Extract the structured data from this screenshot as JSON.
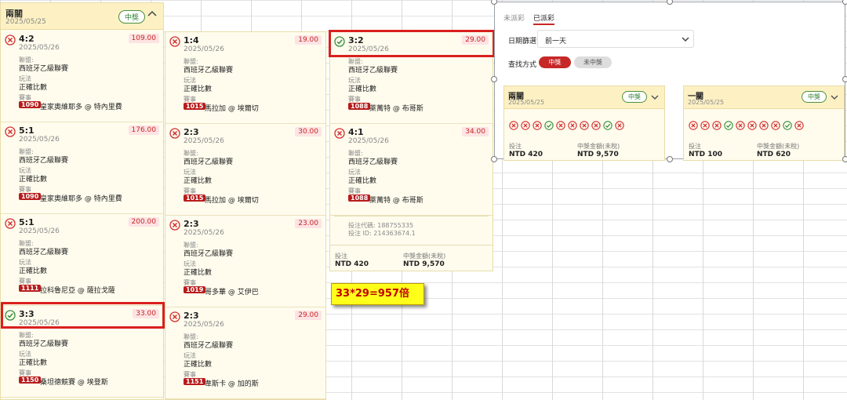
{
  "labels": {
    "league": "聯盟:",
    "play": "玩法",
    "match": "賽事",
    "bet": "投注",
    "payout": "中獎金額(未稅)",
    "bet_code": "投注代碼: 188755335",
    "bet_id": "投注 ID: 214363674.1"
  },
  "ticket1": {
    "title": "兩關",
    "date": "2025/05/25",
    "status": "中獎",
    "cards": [
      {
        "status": "lose",
        "score": "4:2",
        "date": "2025/05/26",
        "odds": "109.00",
        "league": "西班牙乙級聯賽",
        "play": "正確比數",
        "gid": "1090",
        "match": "皇家奧維耶多 @ 特內里費"
      },
      {
        "status": "lose",
        "score": "5:1",
        "date": "2025/05/26",
        "odds": "176.00",
        "league": "西班牙乙級聯賽",
        "play": "正確比數",
        "gid": "1090",
        "match": "皇家奧維耶多 @ 特內里費"
      },
      {
        "status": "lose",
        "score": "5:1",
        "date": "2025/05/26",
        "odds": "200.00",
        "league": "西班牙乙級聯賽",
        "play": "正確比數",
        "gid": "1111",
        "match": "拉科魯尼亞 @ 薩拉戈薩"
      },
      {
        "status": "win",
        "score": "3:3",
        "date": "2025/05/26",
        "odds": "33.00",
        "league": "西班牙乙級聯賽",
        "play": "正確比數",
        "gid": "1150",
        "match": "桑坦德競賽 @ 埃登斯"
      }
    ]
  },
  "ticket2": {
    "cards": [
      {
        "status": "lose",
        "score": "1:4",
        "date": "2025/05/26",
        "odds": "19.00",
        "league": "西班牙乙級聯賽",
        "play": "正確比數",
        "gid": "1015",
        "match": "馬拉加 @ 埃爾切"
      },
      {
        "status": "lose",
        "score": "2:3",
        "date": "2025/05/26",
        "odds": "30.00",
        "league": "西班牙乙級聯賽",
        "play": "正確比數",
        "gid": "1015",
        "match": "馬拉加 @ 埃爾切"
      },
      {
        "status": "lose",
        "score": "2:3",
        "date": "2025/05/26",
        "odds": "23.00",
        "league": "西班牙乙級聯賽",
        "play": "正確比數",
        "gid": "1019",
        "match": "哥多華 @ 艾伊巴"
      },
      {
        "status": "lose",
        "score": "2:3",
        "date": "2025/05/26",
        "odds": "29.00",
        "league": "西班牙乙級聯賽",
        "play": "正確比數",
        "gid": "1151",
        "match": "韋斯卡 @ 加的斯"
      }
    ]
  },
  "ticket3": {
    "cards": [
      {
        "status": "win",
        "score": "3:2",
        "date": "2025/05/26",
        "odds": "29.00",
        "league": "西班牙乙級聯賽",
        "play": "正確比數",
        "gid": "1088",
        "match": "萊萬特 @ 布哥斯"
      },
      {
        "status": "lose",
        "score": "4:1",
        "date": "2025/05/26",
        "odds": "34.00",
        "league": "西班牙乙級聯賽",
        "play": "正確比數",
        "gid": "1088",
        "match": "萊萬特 @ 布哥斯"
      }
    ],
    "bet_value": "NTD 420",
    "payout_value": "NTD 9,570"
  },
  "calc_note": "33*29=957倍",
  "panel": {
    "tab_unsettled": "未派彩",
    "tab_settled": "已派彩",
    "date_filter_label": "日期篩選",
    "date_filter_value": "前一天",
    "search_label": "查找方式",
    "btn_win": "中獎",
    "btn_lose": "未中獎",
    "summaries": [
      {
        "title": "兩關",
        "date": "2025/05/25",
        "status": "中獎",
        "icons": [
          "lose",
          "lose",
          "lose",
          "win",
          "lose",
          "lose",
          "lose",
          "lose",
          "win",
          "lose"
        ],
        "bet": "NTD 420",
        "payout": "NTD 9,570"
      },
      {
        "title": "一關",
        "date": "2025/05/25",
        "status": "中獎",
        "icons": [
          "lose",
          "lose",
          "lose",
          "win",
          "lose",
          "lose",
          "lose",
          "lose",
          "win",
          "lose"
        ],
        "bet": "NTD 100",
        "payout": "NTD 620"
      }
    ]
  },
  "colors": {
    "lose": "#d32f2f",
    "win": "#388e3c",
    "accent": "#c62828",
    "highlight_box": "#d9201e",
    "note_bg": "#ffff1a"
  }
}
